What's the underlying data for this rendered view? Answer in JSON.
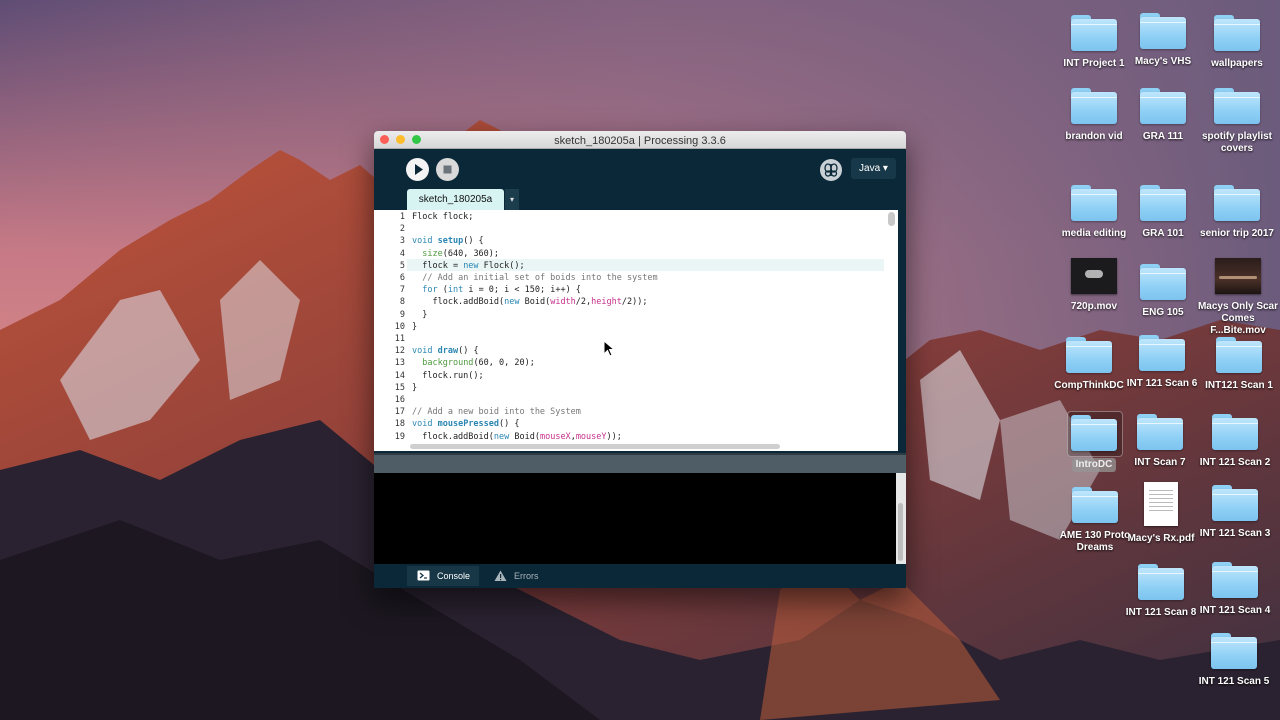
{
  "desktop": {
    "icons": [
      {
        "label": "INT Project 1",
        "type": "folder"
      },
      {
        "label": "Macy's VHS",
        "type": "folder"
      },
      {
        "label": "wallpapers",
        "type": "folder"
      },
      {
        "label": "brandon vid",
        "type": "folder"
      },
      {
        "label": "GRA 111",
        "type": "folder"
      },
      {
        "label": "spotify playlist covers",
        "type": "folder"
      },
      {
        "label": "media editing",
        "type": "folder"
      },
      {
        "label": "GRA 101",
        "type": "folder"
      },
      {
        "label": "senior trip 2017",
        "type": "folder"
      },
      {
        "label": "720p.mov",
        "type": "video"
      },
      {
        "label": "ENG 105",
        "type": "folder"
      },
      {
        "label": "Macys Only Scar Comes F...Bite.mov",
        "type": "video"
      },
      {
        "label": "CompThinkDC",
        "type": "folder"
      },
      {
        "label": "INT 121 Scan 6",
        "type": "folder"
      },
      {
        "label": "INT121 Scan 1",
        "type": "folder"
      },
      {
        "label": "IntroDC",
        "type": "folder",
        "selected": true
      },
      {
        "label": "INT Scan 7",
        "type": "folder"
      },
      {
        "label": "INT 121 Scan 2",
        "type": "folder"
      },
      {
        "label": "AME 130 Proto Dreams",
        "type": "folder"
      },
      {
        "label": "Macy's Rx.pdf",
        "type": "pdf"
      },
      {
        "label": "INT 121 Scan 3",
        "type": "folder"
      },
      {
        "label": "INT 121 Scan 8",
        "type": "folder"
      },
      {
        "label": "INT 121 Scan 4",
        "type": "folder"
      },
      {
        "label": "INT 121 Scan 5",
        "type": "folder"
      }
    ]
  },
  "window": {
    "title": "sketch_180205a | Processing 3.3.6",
    "mode_label": "Java ▾",
    "tab_label": "sketch_180205a",
    "tab_menu_glyph": "▾",
    "code_lines": [
      "Flock flock;",
      "",
      "void setup() {",
      "  size(640, 360);",
      "  flock = new Flock();",
      "  // Add an initial set of boids into the system",
      "  for (int i = 0; i < 150; i++) {",
      "    flock.addBoid(new Boid(width/2,height/2));",
      "  }",
      "}",
      "",
      "void draw() {",
      "  background(60, 0, 20);",
      "  flock.run();",
      "}",
      "",
      "// Add a new boid into the System",
      "void mousePressed() {",
      "  flock.addBoid(new Boid(mouseX,mouseY));"
    ],
    "bottom_tabs": {
      "console": "Console",
      "errors": "Errors"
    }
  },
  "colors": {
    "accent": "#0b2838",
    "tab_bg": "#d7f3f2"
  }
}
